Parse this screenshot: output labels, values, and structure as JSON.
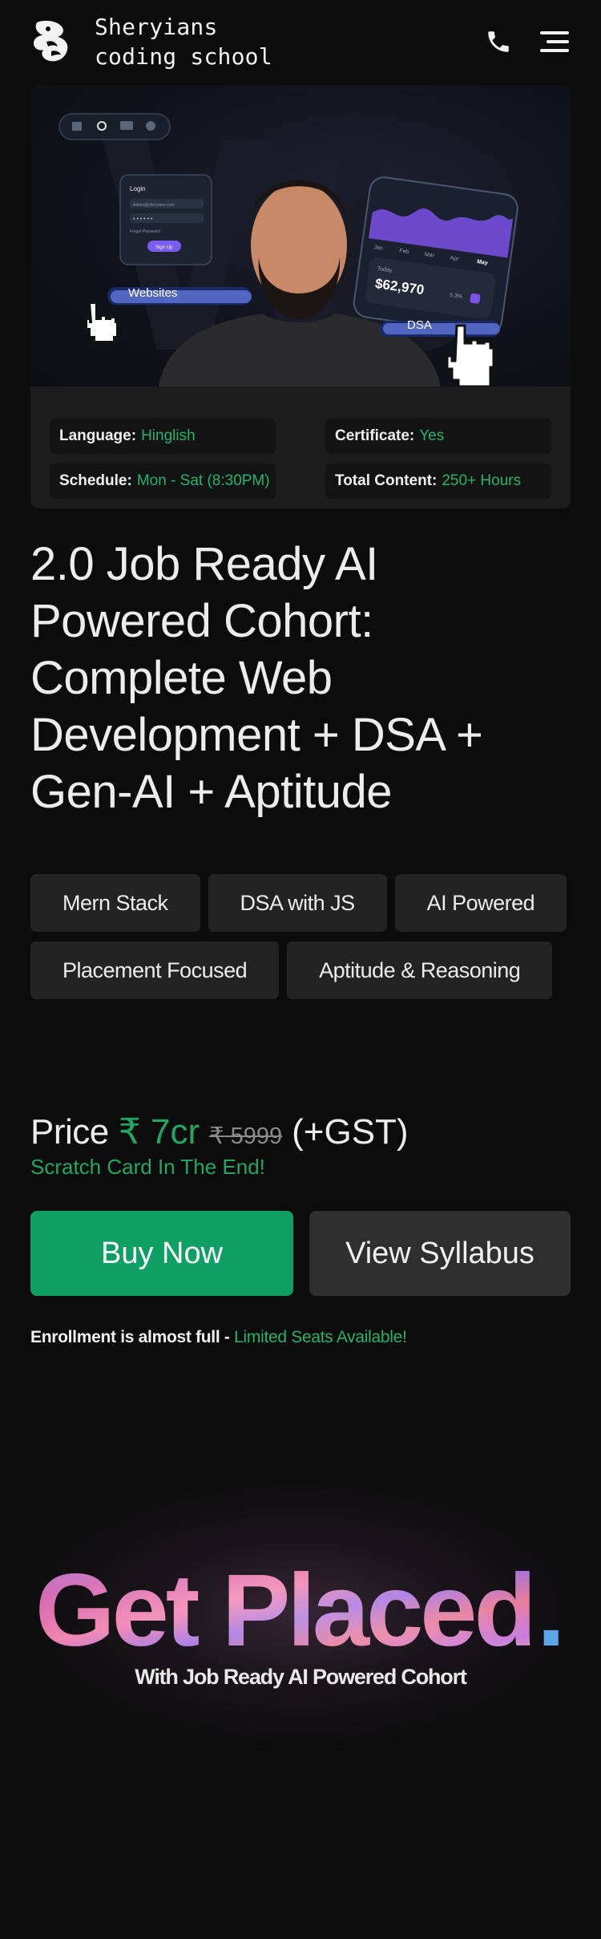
{
  "header": {
    "brand_line1": "Sheryians",
    "brand_line2": "coding school"
  },
  "hero": {
    "mock_login": {
      "title": "Login",
      "email_placeholder": "Admin@sheryians.com",
      "forgot": "Forgot Password",
      "button": "Sign Up"
    },
    "mock_chart": {
      "months": [
        "Jan",
        "Feb",
        "Mar",
        "Apr",
        "May"
      ],
      "today_label": "Today",
      "amount": "$62,970",
      "change": "5.3%"
    },
    "label_websites": "Websites",
    "label_dsa": "DSA"
  },
  "info": {
    "language_label": "Language:",
    "language_value": "Hinglish",
    "certificate_label": "Certificate:",
    "certificate_value": "Yes",
    "schedule_label": "Schedule:",
    "schedule_value": "Mon - Sat (8:30PM)",
    "content_label": "Total Content:",
    "content_value": "250+ Hours"
  },
  "course": {
    "title": "2.0 Job Ready AI Powered Cohort: Complete Web Development + DSA + Gen-AI + Aptitude",
    "tags": [
      "Mern Stack",
      "DSA with JS",
      "AI Powered",
      "Placement Focused",
      "Aptitude & Reasoning"
    ]
  },
  "pricing": {
    "label": "Price",
    "current": "₹ 7cr",
    "original": "₹ 5999",
    "tax": "(+GST)",
    "note": "Scratch Card In The End!"
  },
  "cta": {
    "buy": "Buy Now",
    "syllabus": "View Syllabus"
  },
  "enrollment": {
    "text": "Enrollment is almost full - ",
    "highlight": "Limited Seats Available!"
  },
  "promo": {
    "headline": "Get Placed",
    "headline_dot": ".",
    "subline": "With Job Ready AI Powered Cohort"
  },
  "colors": {
    "accent_green": "#0d9f63",
    "text_green": "#22b46b",
    "background": "#0c0c0c",
    "chip_bg": "#232323"
  }
}
